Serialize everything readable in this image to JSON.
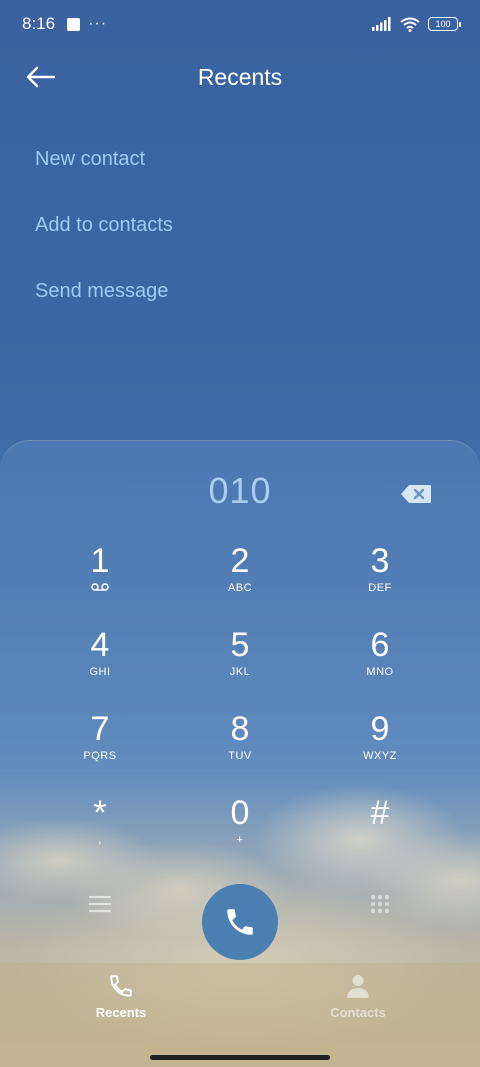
{
  "status_bar": {
    "time": "8:16",
    "dots": "···",
    "battery": "100"
  },
  "header": {
    "title": "Recents"
  },
  "menu": {
    "items": [
      {
        "label": "New contact"
      },
      {
        "label": "Add to contacts"
      },
      {
        "label": "Send message"
      }
    ]
  },
  "dialer": {
    "number": "010",
    "keys": [
      {
        "digit": "1",
        "sub": ""
      },
      {
        "digit": "2",
        "sub": "ABC"
      },
      {
        "digit": "3",
        "sub": "DEF"
      },
      {
        "digit": "4",
        "sub": "GHI"
      },
      {
        "digit": "5",
        "sub": "JKL"
      },
      {
        "digit": "6",
        "sub": "MNO"
      },
      {
        "digit": "7",
        "sub": "PQRS"
      },
      {
        "digit": "8",
        "sub": "TUV"
      },
      {
        "digit": "9",
        "sub": "WXYZ"
      },
      {
        "digit": "*",
        "sub": ","
      },
      {
        "digit": "0",
        "sub": "+"
      },
      {
        "digit": "#",
        "sub": ""
      }
    ]
  },
  "bottom_nav": {
    "tabs": [
      {
        "label": "Recents",
        "icon": "phone-icon"
      },
      {
        "label": "Contacts",
        "icon": "person-icon"
      }
    ]
  },
  "colors": {
    "accent": "#9fcaf5",
    "call_button": "#4b7fb2"
  }
}
